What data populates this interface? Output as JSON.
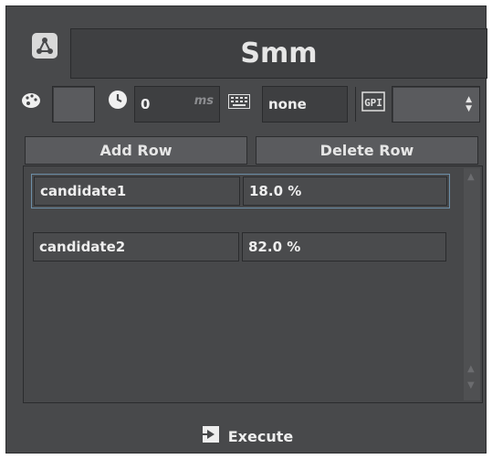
{
  "header": {
    "title": "Smm",
    "title_icon": "node-graph-icon"
  },
  "toolbar": {
    "color_icon": "palette-icon",
    "time_icon": "clock-icon",
    "time_value": "0",
    "time_unit": "ms",
    "keyboard_icon": "keyboard-icon",
    "keyboard_value": "none",
    "gpi_icon": "gpi-icon",
    "gpi_label": "GPI",
    "gpi_value": "",
    "stepper_icon": "up-down-arrows-icon"
  },
  "actions": {
    "add_row": "Add Row",
    "delete_row": "Delete Row"
  },
  "table": {
    "rows": [
      {
        "name": "candidate1",
        "value": "18.0 %",
        "selected": true
      },
      {
        "name": "candidate2",
        "value": "82.0 %",
        "selected": false
      }
    ]
  },
  "footer": {
    "execute_label": "Execute",
    "execute_icon": "execute-icon"
  },
  "colors": {
    "panel_bg": "#48494b",
    "selection_border": "#6d8fa8",
    "text": "#eeeeee"
  }
}
